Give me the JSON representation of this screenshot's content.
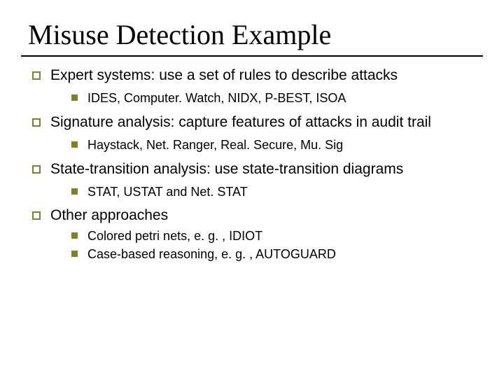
{
  "title": "Misuse Detection Example",
  "items": [
    {
      "text": "Expert systems: use a set of rules to describe attacks",
      "sub": [
        {
          "text": "IDES, Computer. Watch, NIDX, P-BEST, ISOA"
        }
      ]
    },
    {
      "text": "Signature analysis: capture features of attacks in audit trail",
      "sub": [
        {
          "text": "Haystack, Net. Ranger, Real. Secure, Mu. Sig"
        }
      ]
    },
    {
      "text": "State-transition analysis: use state-transition diagrams",
      "sub": [
        {
          "text": "STAT, USTAT and Net. STAT"
        }
      ]
    },
    {
      "text": "Other approaches",
      "sub": [
        {
          "text": "Colored petri nets, e. g. , IDIOT"
        },
        {
          "text": "Case-based reasoning, e. g. , AUTOGUARD"
        }
      ]
    }
  ]
}
